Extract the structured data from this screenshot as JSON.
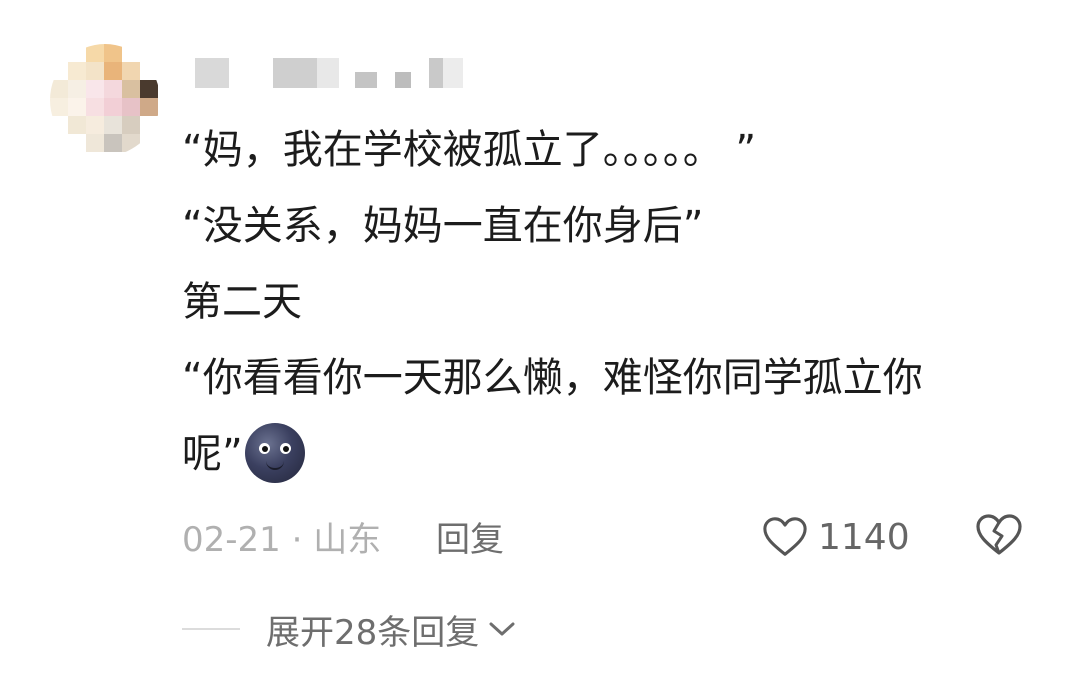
{
  "comment": {
    "lines": [
      "“妈，我在学校被孤立了。。。。。 ”",
      "“没关系，妈妈一直在你身后”",
      "第二天",
      "“你看看你一天那么懒，难怪你同学孤立你",
      "呢”"
    ],
    "emoji": "new-moon-face",
    "date_location": "02-21 · 山东",
    "reply_label": "回复",
    "like_count": "1140",
    "expand_label": "展开28条回复"
  }
}
